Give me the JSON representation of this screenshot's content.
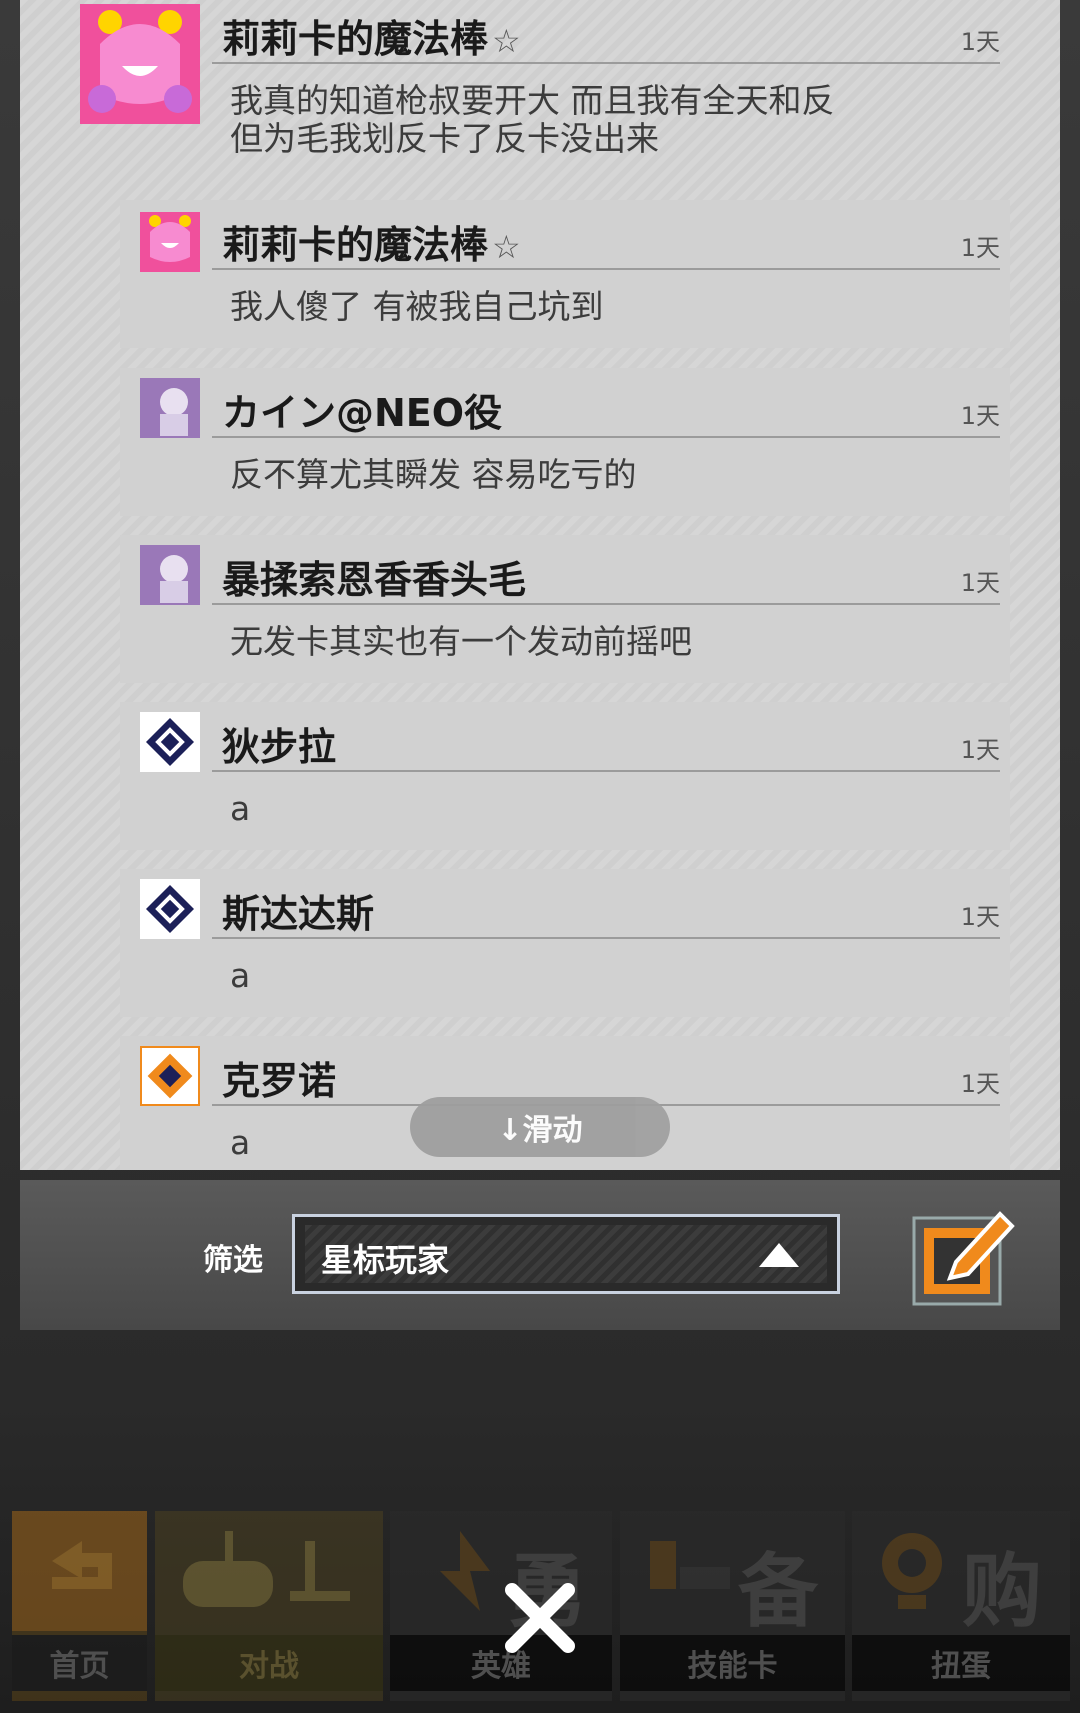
{
  "messages": [
    {
      "name": "莉莉卡的魔法棒",
      "star": "☆",
      "time": "1天",
      "text": "我真的知道枪叔要开大  而且我有全天和反\n但为毛我划反卡了反卡没出来",
      "avatar": "pink-monster-avatar"
    },
    {
      "name": "莉莉卡的魔法棒",
      "star": "☆",
      "time": "1天",
      "text": "我人傻了  有被我自己坑到",
      "avatar": "pink-monster-avatar"
    },
    {
      "name": "カイン@NEO役",
      "star": "",
      "time": "1天",
      "text": "反不算尤其瞬发  容易吃亏的",
      "avatar": "purple-girl-avatar"
    },
    {
      "name": "暴揉索恩香香头毛",
      "star": "",
      "time": "1天",
      "text": "无发卡其实也有一个发动前摇吧",
      "avatar": "purple-girl-avatar"
    },
    {
      "name": "狄步拉",
      "star": "",
      "time": "1天",
      "text": "a",
      "avatar": "navy-diamond-avatar"
    },
    {
      "name": "斯达达斯",
      "star": "",
      "time": "1天",
      "text": "a",
      "avatar": "navy-diamond-avatar"
    },
    {
      "name": "克罗诺",
      "star": "",
      "time": "1天",
      "text": "a",
      "avatar": "orange-diamond-avatar"
    }
  ],
  "scroll_hint": "↓滑动",
  "filter": {
    "label": "筛选",
    "value": "星标玩家"
  },
  "nav": {
    "tabs": [
      {
        "label": "首页",
        "icon": "return-arrow-icon"
      },
      {
        "label": "对战",
        "icon": "gamepad-icon"
      },
      {
        "label": "英雄",
        "icon": "hero-icon"
      },
      {
        "label": "技能卡",
        "icon": "card-icon"
      },
      {
        "label": "扭蛋",
        "icon": "gacha-icon"
      }
    ],
    "icon_chars": [
      "",
      "",
      "勇",
      "备",
      "购"
    ]
  },
  "colors": {
    "accent": "#f08a1c",
    "panel": "#d4d4d4",
    "nav_active": "#3a3510"
  }
}
